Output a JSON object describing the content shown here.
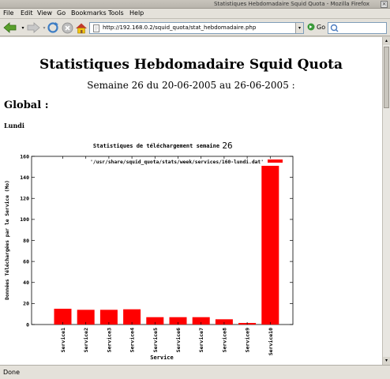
{
  "window": {
    "title": "Statistiques Hebdomadaire Squid Quota - Mozilla Firefox"
  },
  "menu": [
    "File",
    "Edit",
    "View",
    "Go",
    "Bookmarks",
    "Tools",
    "Help"
  ],
  "toolbar": {
    "url": "http://192.168.0.2/squid_quota/stat_hebdomadaire.php",
    "go_label": "Go"
  },
  "page": {
    "title": "Statistiques Hebdomadaire Squid Quota",
    "week": "Semaine 26 du 20-06-2005 au 26-06-2005 :",
    "global": "Global :",
    "day": "Lundi"
  },
  "status": {
    "text": "Done"
  },
  "colors": {
    "bar": "#ff0000"
  },
  "chart_data": {
    "type": "bar",
    "title_prefix": "Statistiques de téléchargement semaine",
    "title_week": "26",
    "legend": "'/usr/share/squid_quota/stats/week/services/160-lundi.dat'",
    "xlabel": "Service",
    "ylabel": "Données Téléchargées par le Service (Mo)",
    "ylim": [
      0,
      160
    ],
    "yticks": [
      0,
      20,
      40,
      60,
      80,
      100,
      120,
      140,
      160
    ],
    "categories": [
      "Service1",
      "Service2",
      "Service3",
      "Service4",
      "Service5",
      "Service6",
      "Service7",
      "Service8",
      "Service9",
      "Service10"
    ],
    "values": [
      15,
      14,
      14,
      14.5,
      7,
      7,
      7,
      5,
      1.5,
      151
    ],
    "legend_position": "top-right"
  }
}
